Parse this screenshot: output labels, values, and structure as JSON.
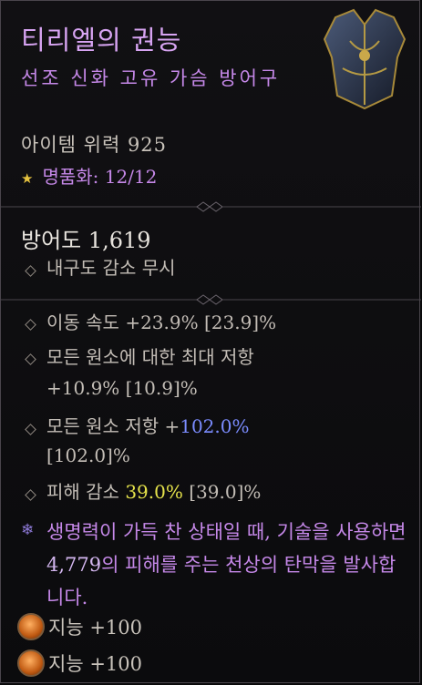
{
  "item": {
    "name": "티리엘의 권능",
    "type_line": "선조 신화 고유 가슴 방어구",
    "item_power": "아이템 위력 925",
    "masterwork": "명품화: 12/12",
    "armor": "방어도 1,619",
    "armor_note": "내구도 감소 무시"
  },
  "affixes": [
    {
      "lines": [
        "이동 속도 +23.9% [23.9]%"
      ]
    },
    {
      "lines": [
        "모든 원소에 대한 최대 저항",
        "+10.9% [10.9]%"
      ]
    },
    {
      "prefix": "모든 원소 저항 +",
      "value": "102.0%",
      "suffix": "",
      "line2": "[102.0]%"
    },
    {
      "prefix": "피해 감소 ",
      "value": "39.0%",
      "suffix": " [39.0]%"
    }
  ],
  "unique_effect": {
    "text1": "생명력이 가득 찬 상태일 때, 기술을 사용하면 ",
    "value": "4,779",
    "text2": "의 피해를 주는 천상의 탄막을 발사합니다."
  },
  "sockets": [
    {
      "label": "지능 +100"
    },
    {
      "label": "지능 +100"
    }
  ],
  "colors": {
    "title": "#d7a4f2",
    "mythic_purple": "#c588e8",
    "blue_value": "#7b8cff",
    "yellow_value": "#e6e34b",
    "masterwork_star": "#e5c23f"
  }
}
